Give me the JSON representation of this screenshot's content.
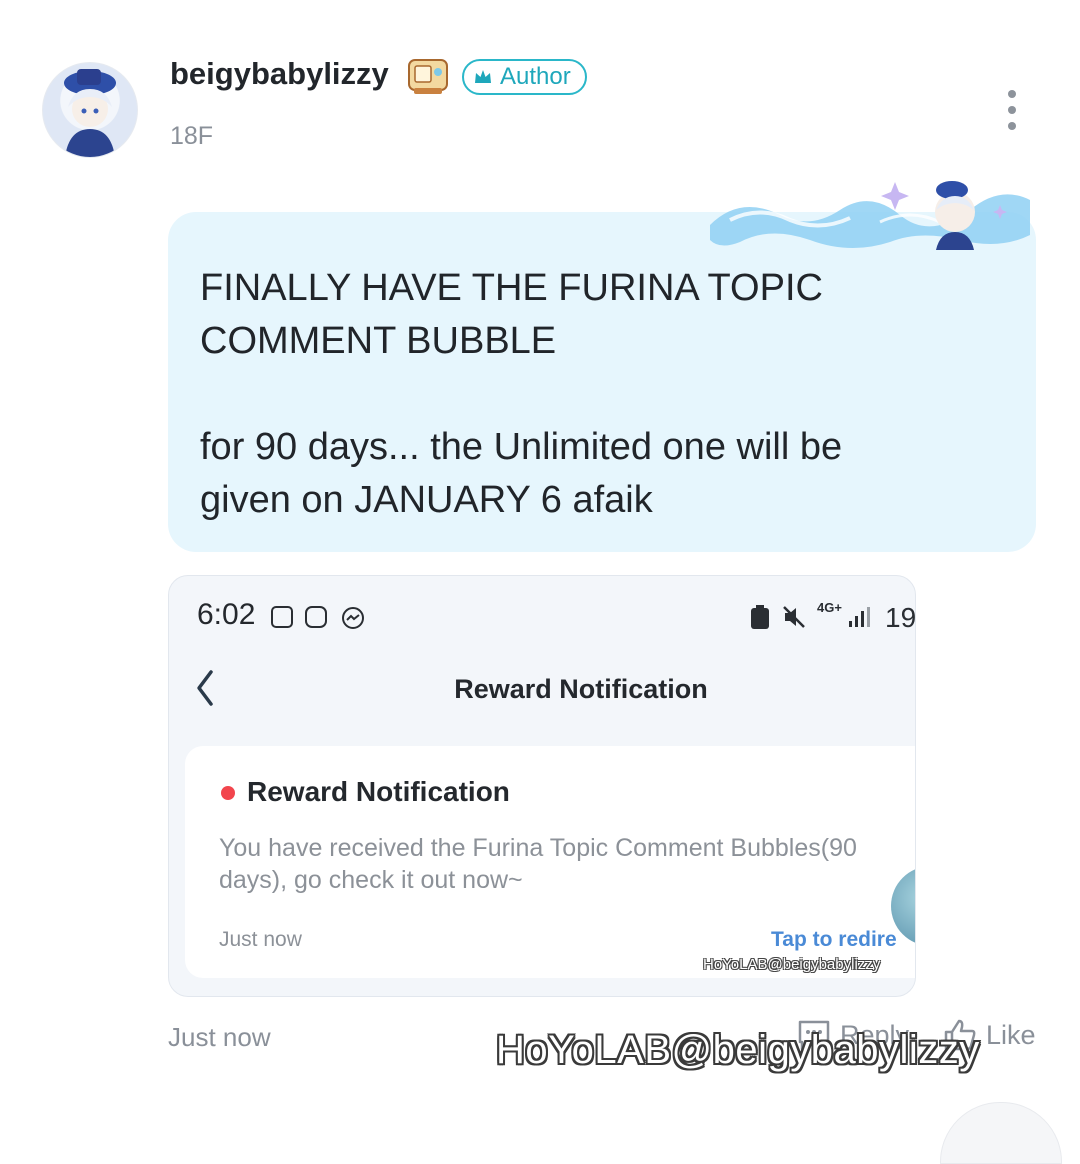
{
  "post": {
    "username": "beigybabylizzy",
    "author_badge": "Author",
    "floor": "18F",
    "bubble_text": "FINALLY HAVE THE FURINA TOPIC\nCOMMENT BUBBLE\n\nfor 90 days... the Unlimited one will be\ngiven on JANUARY 6 afaik",
    "timestamp": "Just now",
    "reply_label": "Reply",
    "like_label": "Like",
    "watermark": "HoYoLAB@beigybabylizzy"
  },
  "screenshot": {
    "status_time": "6:02",
    "status_right": "19",
    "network": "4G+",
    "nav_title": "Reward Notification",
    "card": {
      "title": "Reward Notification",
      "body": "You have received the Furina Topic Comment Bubbles(90 days), go check it out now~",
      "time": "Just now",
      "link": "Tap to redire",
      "watermark": "HoYoLAB@beigybabylizzy"
    }
  },
  "colors": {
    "accent": "#2ab7c9",
    "bubble_bg": "#e6f6fd",
    "link": "#4a8ad6",
    "unread_dot": "#f2454d"
  }
}
